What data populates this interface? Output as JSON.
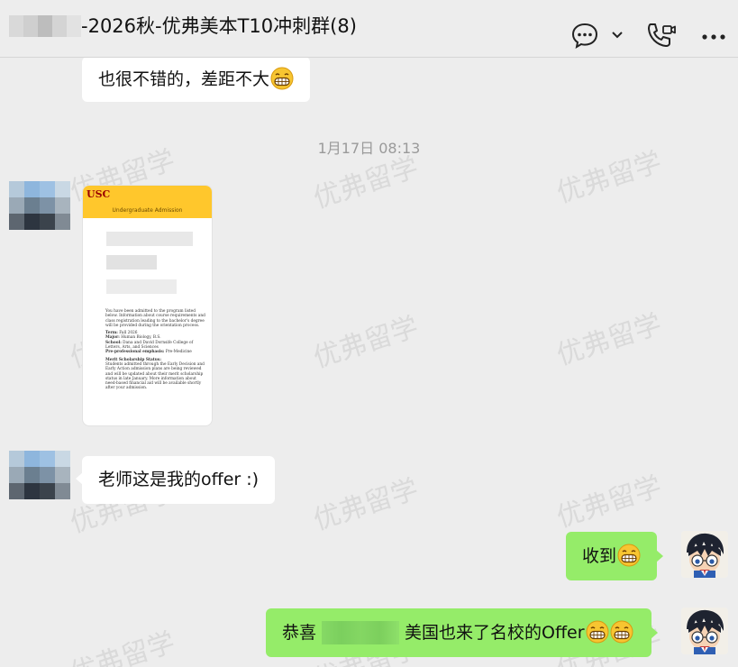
{
  "header": {
    "title": "-2026秋-优弗美本T10冲刺群(8)",
    "icons": [
      "chat-bubble-icon",
      "chevron-down-icon",
      "voice-video-call-icon",
      "more-icon"
    ]
  },
  "watermark": "优弗留学",
  "messages": {
    "prev_reply": "也很不错的，差距不大",
    "timestamp": "1月17日 08:13",
    "offer_letter": {
      "logo": "USC",
      "banner": "Undergraduate Admission",
      "para1": "You have been admitted to the program listed below. Information about course requirements and class registration leading to the bachelor's degree will be provided during the orientation process.",
      "term_label": "Term:",
      "term": "Fall 2026",
      "major_label": "Major:",
      "major": "Human Biology, B.S.",
      "school_label": "School:",
      "school": "Dana and David Dornsife College of Letters, Arts, and Sciences",
      "emphasis_label": "Pre-professional emphasis:",
      "emphasis": "Pre-Medicine",
      "merit_title": "Merit Scholarship Status:",
      "merit_text": "Students admitted through the Early Decision and Early Action admission plans are being reviewed and will be updated about their merit scholarship status in late January. More information about need-based financial aid will be available shortly after your admission."
    },
    "student_msg": "老师这是我的offer :)",
    "reply_received": "收到",
    "reply_congrats_pre": "恭喜",
    "reply_congrats_post": "美国也来了名校的Offer"
  },
  "colors": {
    "background": "#ededed",
    "bubble_self": "#95ec69",
    "bubble_other": "#ffffff",
    "usc_gold": "#ffc72c",
    "usc_cardinal": "#990000"
  }
}
